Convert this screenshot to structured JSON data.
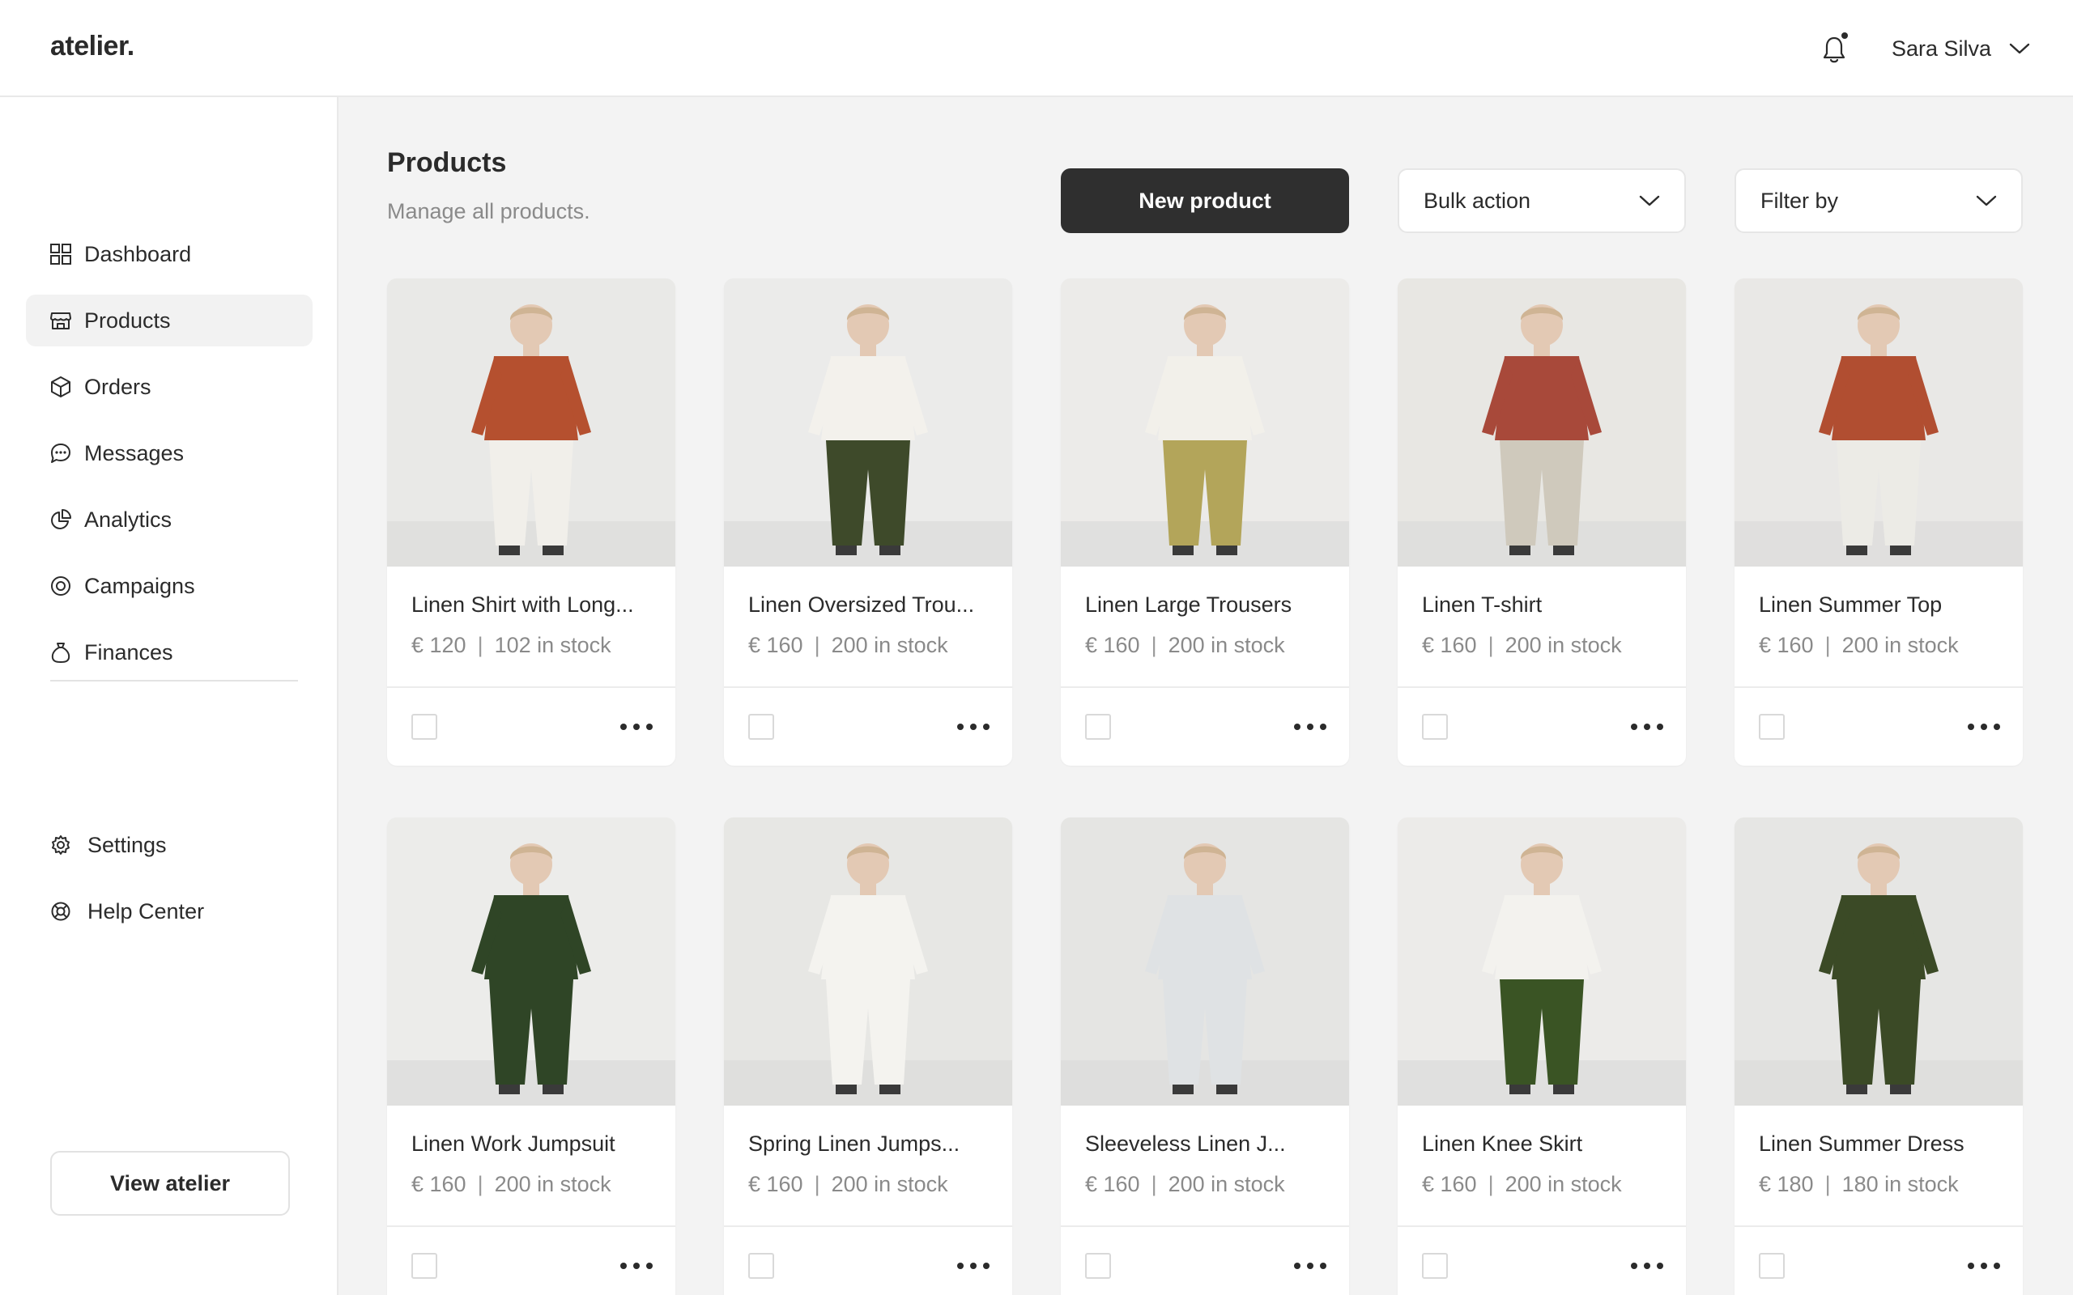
{
  "app": {
    "logo": "atelier."
  },
  "header": {
    "user_name": "Sara Silva",
    "notification_icon": "bell-icon",
    "has_unread": true
  },
  "sidebar": {
    "items": [
      {
        "label": "Dashboard",
        "icon": "grid-icon",
        "active": false
      },
      {
        "label": "Products",
        "icon": "store-icon",
        "active": true
      },
      {
        "label": "Orders",
        "icon": "box-icon",
        "active": false
      },
      {
        "label": "Messages",
        "icon": "chat-icon",
        "active": false
      },
      {
        "label": "Analytics",
        "icon": "chart-icon",
        "active": false
      },
      {
        "label": "Campaigns",
        "icon": "target-icon",
        "active": false
      },
      {
        "label": "Finances",
        "icon": "money-bag-icon",
        "active": false
      }
    ],
    "secondary_items": [
      {
        "label": "Settings",
        "icon": "gear-icon"
      },
      {
        "label": "Help Center",
        "icon": "lifebuoy-icon"
      }
    ],
    "view_button": "View atelier"
  },
  "main": {
    "title": "Products",
    "subtitle": "Manage all products.",
    "new_product_label": "New product",
    "bulk_action_label": "Bulk action",
    "filter_label": "Filter by"
  },
  "colors": {
    "primary_button": "#2f2f2f",
    "background": "#f3f3f3",
    "card": "#ffffff",
    "muted_text": "#8a8a8a"
  },
  "products": [
    {
      "name": "Linen Shirt with Long...",
      "price": "€ 120",
      "stock": "102 in stock",
      "garment": "#b5502f",
      "bottom": "#f1efea",
      "backdrop": "#e9e9e7"
    },
    {
      "name": "Linen Oversized Trou...",
      "price": "€ 160",
      "stock": "200 in stock",
      "garment": "#f3f1ec",
      "bottom": "#3e4a2a",
      "backdrop": "#ebebea"
    },
    {
      "name": "Linen Large Trousers",
      "price": "€ 160",
      "stock": "200 in stock",
      "garment": "#f2f0ea",
      "bottom": "#b3a55a",
      "backdrop": "#ecebe9"
    },
    {
      "name": "Linen T-shirt",
      "price": "€ 160",
      "stock": "200 in stock",
      "garment": "#a8493a",
      "bottom": "#cfc9bc",
      "backdrop": "#e8e7e3"
    },
    {
      "name": "Linen Summer Top",
      "price": "€ 160",
      "stock": "200 in stock",
      "garment": "#b14e31",
      "bottom": "#ecebe6",
      "backdrop": "#e9e8e6"
    },
    {
      "name": "Linen Work Jumpsuit",
      "price": "€ 160",
      "stock": "200 in stock",
      "garment": "#2f4526",
      "bottom": "#2f4526",
      "backdrop": "#ececea"
    },
    {
      "name": "Spring Linen Jumps...",
      "price": "€ 160",
      "stock": "200 in stock",
      "garment": "#f4f3ef",
      "bottom": "#f4f3ef",
      "backdrop": "#e7e7e4"
    },
    {
      "name": "Sleeveless Linen J...",
      "price": "€ 160",
      "stock": "200 in stock",
      "garment": "#dfe2e4",
      "bottom": "#dfe2e4",
      "backdrop": "#e5e5e3"
    },
    {
      "name": "Linen Knee Skirt",
      "price": "€ 160",
      "stock": "200 in stock",
      "garment": "#f3f2ee",
      "bottom": "#3a5424",
      "backdrop": "#ecebe9"
    },
    {
      "name": "Linen Summer Dress",
      "price": "€ 180",
      "stock": "180 in stock",
      "garment": "#3b4a26",
      "bottom": "#3b4a26",
      "backdrop": "#e6e6e4"
    }
  ]
}
